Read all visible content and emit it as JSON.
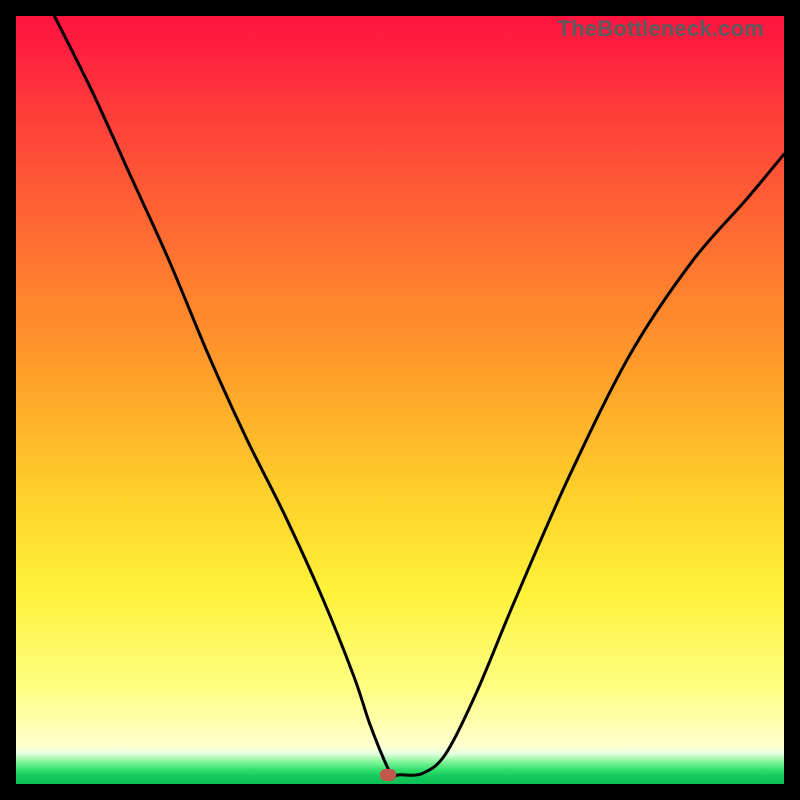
{
  "watermark": "TheBottleneck.com",
  "colors": {
    "frame_border": "#000000",
    "marker": "#c1584b",
    "curve": "#000000",
    "gradient_top": "#ff1440",
    "gradient_bottom": "#0cbf55"
  },
  "chart_data": {
    "type": "line",
    "title": "",
    "xlabel": "",
    "ylabel": "",
    "xlim": [
      0,
      100
    ],
    "ylim": [
      0,
      100
    ],
    "annotations": [
      {
        "type": "marker",
        "x": 48.5,
        "y": 1.2,
        "shape": "rounded-rect",
        "color": "#c1584b"
      }
    ],
    "series": [
      {
        "name": "bottleneck-curve",
        "x": [
          5,
          10,
          15,
          20,
          25,
          30,
          35,
          40,
          44,
          46,
          48,
          49,
          50,
          53,
          56,
          60,
          65,
          72,
          80,
          88,
          95,
          100
        ],
        "y": [
          100,
          90,
          79,
          68,
          56,
          45,
          35,
          24,
          14,
          8,
          3,
          1.2,
          1.2,
          1.4,
          4,
          12,
          24,
          40,
          56,
          68,
          76,
          82
        ]
      }
    ]
  }
}
